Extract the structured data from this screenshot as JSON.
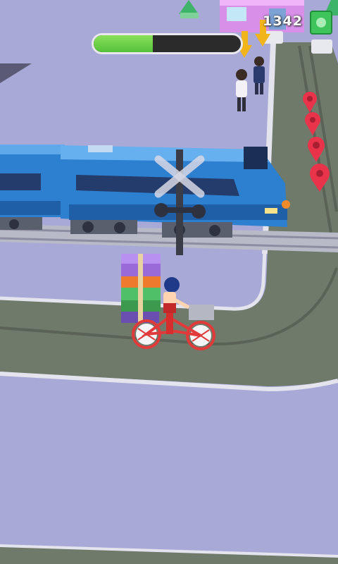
{
  "hud": {
    "money": "1342",
    "money_icon": "cash-icon",
    "delivery_progress": 0.4
  },
  "colors": {
    "ground": "#a8a9d6",
    "road": "#6f7a6a",
    "train": "#2d7fd0",
    "progress_fill": "#55c13a",
    "map_pin": "#e8334a",
    "arrow": "#f2b41b"
  }
}
